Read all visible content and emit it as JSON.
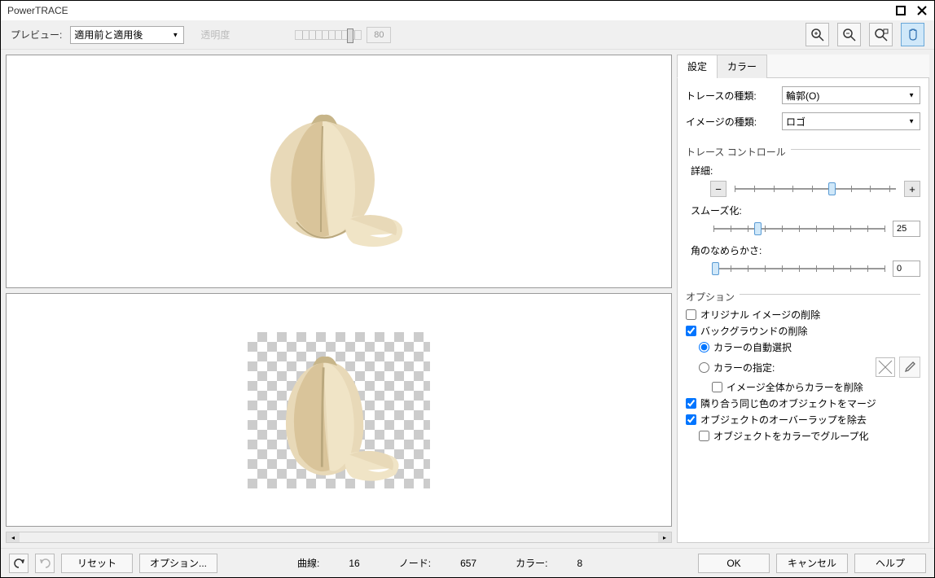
{
  "title": "PowerTRACE",
  "toolbar": {
    "preview_label": "プレビュー:",
    "preview_mode": "適用前と適用後",
    "transparency_label": "透明度",
    "transparency_value": "80"
  },
  "tabs": {
    "settings_label": "設定",
    "color_label": "カラー"
  },
  "settings": {
    "trace_type_label": "トレースの種類:",
    "trace_type_value": "輪郭(O)",
    "image_type_label": "イメージの種類:",
    "image_type_value": "ロゴ",
    "trace_control_header": "トレース コントロール",
    "detail_label": "詳細:",
    "smoothing_label": "スムーズ化:",
    "smoothing_value": "25",
    "corner_label": "角のなめらかさ:",
    "corner_value": "0",
    "options_header": "オプション",
    "opt_delete_original": "オリジナル イメージの削除",
    "opt_delete_bg": "バックグラウンドの削除",
    "opt_auto_color": "カラーの自動選択",
    "opt_specify_color": "カラーの指定:",
    "opt_remove_from_image": "イメージ全体からカラーを削除",
    "opt_merge_same": "隣り合う同じ色のオブジェクトをマージ",
    "opt_remove_overlap": "オブジェクトのオーバーラップを除去",
    "opt_group_by_color": "オブジェクトをカラーでグループ化"
  },
  "footer": {
    "reset": "リセット",
    "options": "オプション...",
    "curves_label": "曲線:",
    "curves_value": "16",
    "nodes_label": "ノード:",
    "nodes_value": "657",
    "colors_label": "カラー:",
    "colors_value": "8",
    "ok": "OK",
    "cancel": "キャンセル",
    "help": "ヘルプ"
  }
}
